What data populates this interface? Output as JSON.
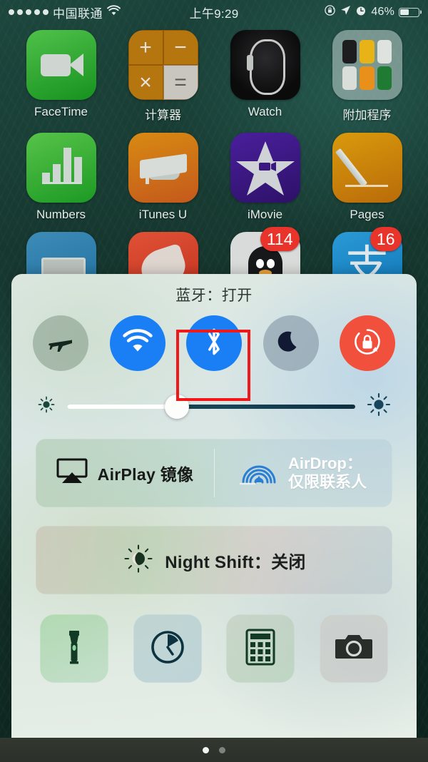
{
  "status_bar": {
    "signal_dots": 5,
    "carrier": "中国联通",
    "wifi_icon": "wifi-icon",
    "time": "上午9:29",
    "rotation_lock_icon": "rotation-lock-icon",
    "location_icon": "location-arrow-icon",
    "alarm_icon": "alarm-clock-icon",
    "battery_percent": "46%",
    "battery_level": 46
  },
  "home_screen": {
    "rows": [
      [
        {
          "label": "FaceTime",
          "icon": "facetime-icon",
          "badge": null
        },
        {
          "label": "计算器",
          "icon": "calculator-app-icon",
          "badge": null
        },
        {
          "label": "Watch",
          "icon": "watch-app-icon",
          "badge": null
        },
        {
          "label": "附加程序",
          "icon": "folder-icon",
          "badge": null
        }
      ],
      [
        {
          "label": "Numbers",
          "icon": "numbers-icon",
          "badge": null
        },
        {
          "label": "iTunes U",
          "icon": "itunes-u-icon",
          "badge": null
        },
        {
          "label": "iMovie",
          "icon": "imovie-icon",
          "badge": null
        },
        {
          "label": "Pages",
          "icon": "pages-icon",
          "badge": null
        }
      ],
      [
        {
          "label": "",
          "icon": "keynote-icon",
          "badge": null
        },
        {
          "label": "",
          "icon": "garageband-icon",
          "badge": null
        },
        {
          "label": "",
          "icon": "qq-icon",
          "badge": "114"
        },
        {
          "label": "",
          "icon": "alipay-icon",
          "badge": "16"
        }
      ]
    ],
    "calculator_keys": [
      "+",
      "−",
      "×",
      "="
    ],
    "alipay_glyph": "支",
    "page_dots": {
      "count": 2,
      "active_index": 0
    }
  },
  "control_center": {
    "banner": "蓝牙：打开",
    "toggles": [
      {
        "name": "airplane-mode-toggle",
        "icon": "airplane-icon",
        "state": "off"
      },
      {
        "name": "wifi-toggle",
        "icon": "wifi-icon",
        "state": "on"
      },
      {
        "name": "bluetooth-toggle",
        "icon": "bluetooth-icon",
        "state": "on",
        "highlighted": true
      },
      {
        "name": "do-not-disturb-toggle",
        "icon": "moon-icon",
        "state": "off"
      },
      {
        "name": "rotation-lock-toggle",
        "icon": "rotation-lock-icon",
        "state": "on"
      }
    ],
    "brightness": {
      "label_low_icon": "small-sun-icon",
      "label_high_icon": "large-sun-icon",
      "value_percent": 38
    },
    "airplay": {
      "icon": "airplay-icon",
      "label": "AirPlay 镜像"
    },
    "airdrop": {
      "icon": "airdrop-icon",
      "label_line1": "AirDrop：",
      "label_line2": "仅限联系人"
    },
    "night_shift": {
      "icon": "night-shift-icon",
      "label": "Night Shift：关闭"
    },
    "shortcuts": [
      {
        "name": "flashlight-shortcut",
        "icon": "flashlight-icon"
      },
      {
        "name": "timer-shortcut",
        "icon": "timer-icon"
      },
      {
        "name": "calculator-shortcut",
        "icon": "calculator-icon"
      },
      {
        "name": "camera-shortcut",
        "icon": "camera-icon"
      }
    ]
  },
  "colors": {
    "toggle_on_blue": "#1a7ef5",
    "toggle_on_red": "#f0503c",
    "highlight_red": "#f01818",
    "badge_red": "#e8342a"
  }
}
